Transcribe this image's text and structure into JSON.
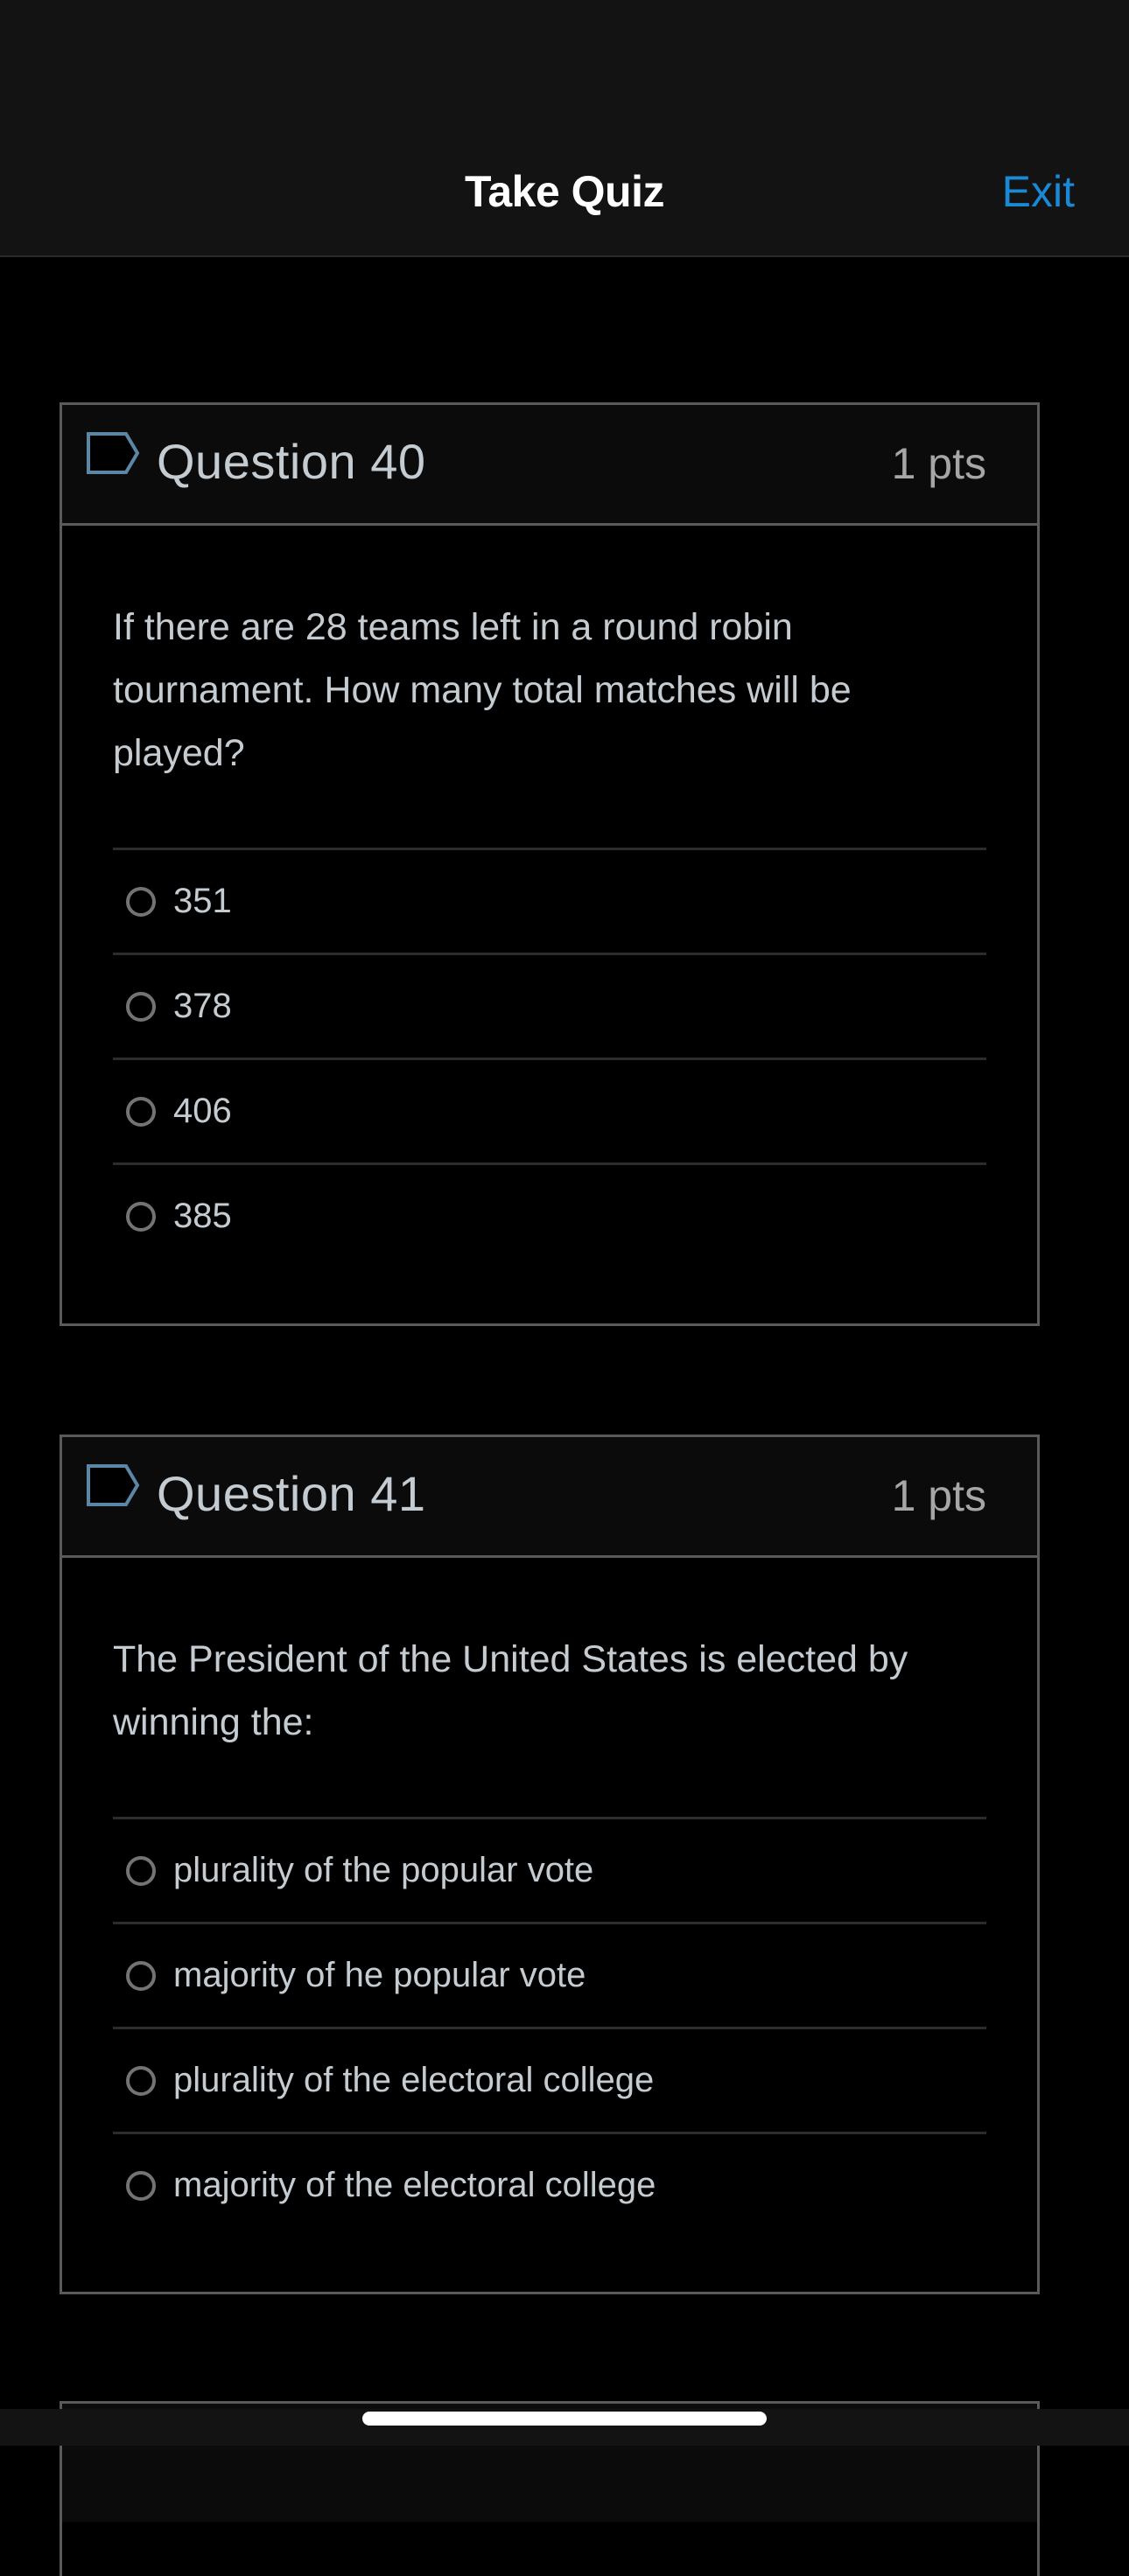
{
  "navbar": {
    "title": "Take Quiz",
    "exit_label": "Exit",
    "accent_color": "#1a8ad6"
  },
  "questions": [
    {
      "title": "Question 40",
      "points": "1 pts",
      "flag_icon": "flag-outline-icon",
      "text": "If there are 28 teams left in a round robin tournament. How many total matches will be played?",
      "answers": [
        "351",
        "378",
        "406",
        "385"
      ],
      "selected": null
    },
    {
      "title": "Question 41",
      "points": "1 pts",
      "flag_icon": "flag-outline-icon",
      "text": "The President of the United States is elected by winning the:",
      "answers": [
        "plurality of the popular vote",
        "majority of he popular vote",
        "plurality of the electoral college",
        "majority of the electoral college"
      ],
      "selected": null
    }
  ]
}
